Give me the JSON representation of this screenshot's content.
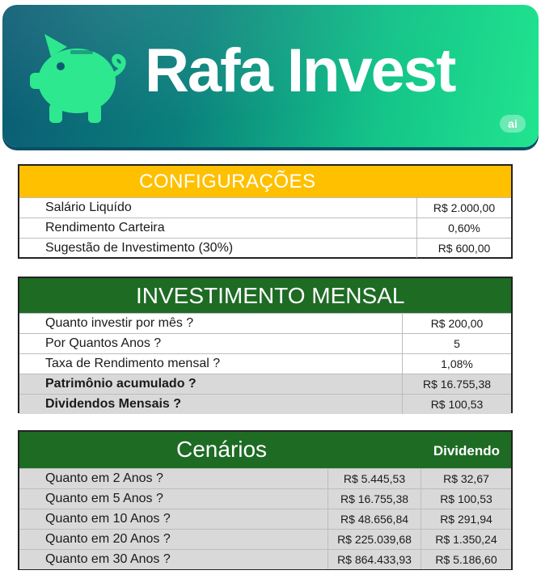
{
  "banner": {
    "brand": "Rafa Invest",
    "badge": "ai",
    "logo_icon": "piggy-bank-icon",
    "colors": {
      "gradient_start": "#0b5b73",
      "gradient_end": "#21e58f"
    }
  },
  "configuracoes": {
    "title": "CONFIGURAÇÕES",
    "rows": [
      {
        "label": "Salário Liquído",
        "value": "R$ 2.000,00"
      },
      {
        "label": "Rendimento Carteira",
        "value": "0,60%"
      },
      {
        "label": "Sugestão de Investimento (30%)",
        "value": "R$ 600,00"
      }
    ]
  },
  "investimento": {
    "title": "INVESTIMENTO MENSAL",
    "rows": [
      {
        "label": "Quanto investir por mês ?",
        "value": "R$ 200,00"
      },
      {
        "label": "Por Quantos Anos ?",
        "value": "5"
      },
      {
        "label": "Taxa de Rendimento mensal ?",
        "value": "1,08%"
      },
      {
        "label": "Patrimônio acumulado ?",
        "value": "R$ 16.755,38"
      },
      {
        "label": "Dividendos Mensais ?",
        "value": "R$ 100,53"
      }
    ]
  },
  "cenarios": {
    "title": "Cenários",
    "dividend_header": "Dividendo",
    "rows": [
      {
        "label": "Quanto em 2 Anos ?",
        "total": "R$ 5.445,53",
        "dividendo": "R$ 32,67"
      },
      {
        "label": "Quanto em 5 Anos ?",
        "total": "R$ 16.755,38",
        "dividendo": "R$ 100,53"
      },
      {
        "label": "Quanto em 10 Anos ?",
        "total": "R$ 48.656,84",
        "dividendo": "R$ 291,94"
      },
      {
        "label": "Quanto em 20 Anos ?",
        "total": "R$ 225.039,68",
        "dividendo": "R$ 1.350,24"
      },
      {
        "label": "Quanto em 30 Anos ?",
        "total": "R$ 864.433,93",
        "dividendo": "R$ 5.186,60"
      }
    ]
  },
  "colors": {
    "config_header": "#ffc000",
    "green_header": "#1e6b24",
    "highlight_row": "#d9d9d9"
  }
}
